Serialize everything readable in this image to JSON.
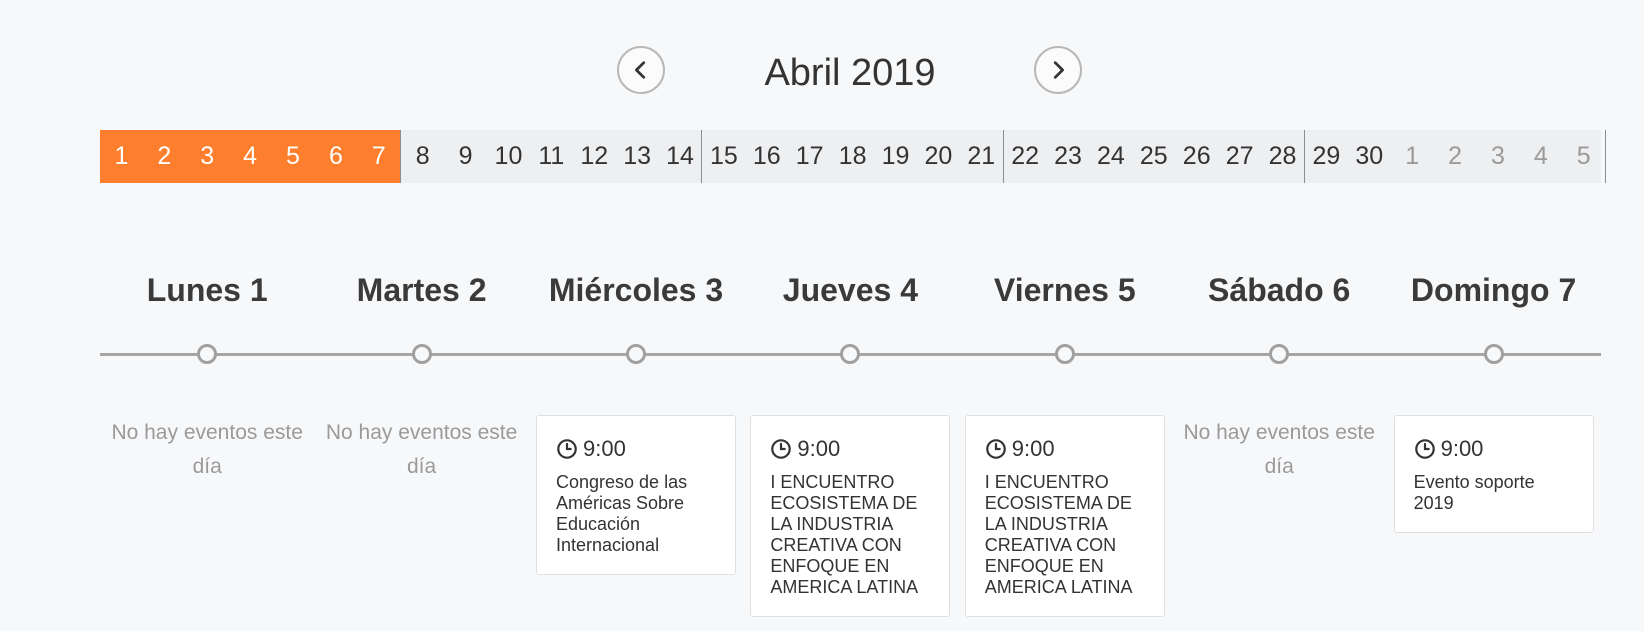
{
  "header": {
    "month_title": "Abril 2019",
    "prev_icon": "chevron-left-icon",
    "next_icon": "chevron-right-icon"
  },
  "colors": {
    "accent": "#fd7e2c",
    "background": "#f7f8fa",
    "strip": "#eeeff1"
  },
  "day_strip": {
    "weeks": [
      {
        "active": true,
        "days": [
          {
            "n": "1"
          },
          {
            "n": "2"
          },
          {
            "n": "3"
          },
          {
            "n": "4"
          },
          {
            "n": "5"
          },
          {
            "n": "6"
          },
          {
            "n": "7"
          }
        ]
      },
      {
        "active": false,
        "days": [
          {
            "n": "8"
          },
          {
            "n": "9"
          },
          {
            "n": "10"
          },
          {
            "n": "11"
          },
          {
            "n": "12"
          },
          {
            "n": "13"
          },
          {
            "n": "14"
          }
        ]
      },
      {
        "active": false,
        "days": [
          {
            "n": "15"
          },
          {
            "n": "16"
          },
          {
            "n": "17"
          },
          {
            "n": "18"
          },
          {
            "n": "19"
          },
          {
            "n": "20"
          },
          {
            "n": "21"
          }
        ]
      },
      {
        "active": false,
        "days": [
          {
            "n": "22"
          },
          {
            "n": "23"
          },
          {
            "n": "24"
          },
          {
            "n": "25"
          },
          {
            "n": "26"
          },
          {
            "n": "27"
          },
          {
            "n": "28"
          }
        ]
      },
      {
        "active": false,
        "days": [
          {
            "n": "29"
          },
          {
            "n": "30"
          },
          {
            "n": "1",
            "muted": true
          },
          {
            "n": "2",
            "muted": true
          },
          {
            "n": "3",
            "muted": true
          },
          {
            "n": "4",
            "muted": true
          },
          {
            "n": "5",
            "muted": true
          }
        ]
      }
    ]
  },
  "week_view": {
    "days": [
      {
        "label": "Lunes 1",
        "no_events": "No hay eventos este día",
        "events": []
      },
      {
        "label": "Martes 2",
        "no_events": "No hay eventos este día",
        "events": []
      },
      {
        "label": "Miércoles 3",
        "events": [
          {
            "time": "9:00",
            "title": "Congreso de las Américas Sobre Educación Internacional"
          }
        ]
      },
      {
        "label": "Jueves 4",
        "events": [
          {
            "time": "9:00",
            "title": "I ENCUENTRO ECOSISTEMA DE LA INDUSTRIA CREATIVA CON ENFOQUE EN AMERICA LATINA"
          }
        ]
      },
      {
        "label": "Viernes 5",
        "events": [
          {
            "time": "9:00",
            "title": "I ENCUENTRO ECOSISTEMA DE LA INDUSTRIA CREATIVA CON ENFOQUE EN AMERICA LATINA"
          }
        ]
      },
      {
        "label": "Sábado 6",
        "no_events": "No hay eventos este día",
        "events": []
      },
      {
        "label": "Domingo 7",
        "events": [
          {
            "time": "9:00",
            "title": "Evento soporte 2019"
          }
        ]
      }
    ],
    "time_icon": "clock-icon"
  }
}
